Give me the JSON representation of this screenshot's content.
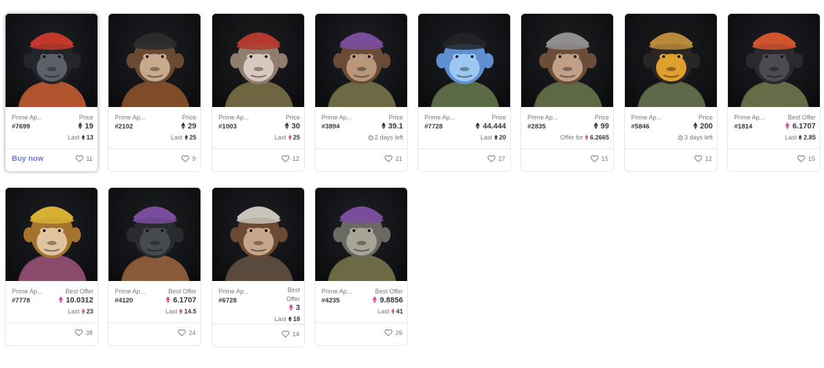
{
  "cards": [
    {
      "collection": "Prime Ap...",
      "token": "#7699",
      "label": "Price",
      "price": "19",
      "price_icon": "eth-black",
      "sub_label": "Last",
      "sub_value": "13",
      "sub_icon": "eth-black",
      "likes": "11",
      "buy": "Buy now",
      "bg": "#1e2126",
      "hat": "#c4382c",
      "fur": "#23252a",
      "face": "#5c6068",
      "jacket": "#b0552e"
    },
    {
      "collection": "Prime Ap...",
      "token": "#2102",
      "label": "Price",
      "price": "29",
      "price_icon": "eth-black",
      "sub_label": "Last",
      "sub_value": "25",
      "sub_icon": "eth-black",
      "likes": "9",
      "bg": "#1d1e21",
      "hat": "#2b2b2e",
      "fur": "#6b4a33",
      "face": "#c9a98d",
      "jacket": "#7f4c2a"
    },
    {
      "collection": "Prime Ap...",
      "token": "#1003",
      "label": "Price",
      "price": "30",
      "price_icon": "eth-black",
      "sub_label": "Last",
      "sub_value": "25",
      "sub_icon": "eth-pink",
      "likes": "12",
      "bg": "#1f1e1c",
      "hat": "#b4382e",
      "fur": "#8f7d70",
      "face": "#d8c8c0",
      "jacket": "#6f6540"
    },
    {
      "collection": "Prime Ap...",
      "token": "#3894",
      "label": "Price",
      "price": "39.1",
      "price_icon": "eth-black",
      "sub_label": "2 days left",
      "sub_value": "",
      "sub_icon": "clock",
      "likes": "21",
      "bg": "#202124",
      "hat": "#7a4c9c",
      "fur": "#6a4b35",
      "face": "#b8977a",
      "jacket": "#6b6a45"
    },
    {
      "collection": "Prime Ap...",
      "token": "#7728",
      "label": "Price",
      "price": "44.444",
      "price_icon": "eth-black",
      "sub_label": "Last",
      "sub_value": "20",
      "sub_icon": "eth-black",
      "likes": "27",
      "bg": "#1c1d20",
      "hat": "#222326",
      "fur": "#5f8fd0",
      "face": "#9cc7f0",
      "jacket": "#5c6a45"
    },
    {
      "collection": "Prime Ap...",
      "token": "#2835",
      "label": "Price",
      "price": "99",
      "price_icon": "eth-black",
      "sub_label": "Offer for",
      "sub_value": "6.2665",
      "sub_icon": "eth-pink",
      "likes": "15",
      "bg": "#1f2022",
      "hat": "#8f8f90",
      "fur": "#6b4e3a",
      "face": "#c2a088",
      "jacket": "#5d6945"
    },
    {
      "collection": "Prime Ap...",
      "token": "#5846",
      "label": "Price",
      "price": "200",
      "price_icon": "eth-black",
      "sub_label": "3 days left",
      "sub_value": "",
      "sub_icon": "clock",
      "likes": "12",
      "bg": "#1a1a1c",
      "hat": "#b98a3a",
      "fur": "#2a2624",
      "face": "#e0a030",
      "jacket": "#5f6848"
    },
    {
      "collection": "Prime Ap...",
      "token": "#1814",
      "label": "Best Offer",
      "price": "6.1707",
      "price_icon": "eth-pink",
      "sub_label": "Last",
      "sub_value": "2.85",
      "sub_icon": "eth-black",
      "likes": "15",
      "bg": "#1d1e21",
      "hat": "#d0542c",
      "fur": "#2a2a2e",
      "face": "#4a4c52",
      "jacket": "#656c48"
    },
    {
      "collection": "Prime Ap...",
      "token": "#7778",
      "label": "Best Offer",
      "price": "10.0312",
      "price_icon": "eth-pink",
      "sub_label": "Last",
      "sub_value": "23",
      "sub_icon": "eth-pink",
      "likes": "38",
      "bg": "#1e1f22",
      "hat": "#d8b032",
      "fur": "#a4742f",
      "face": "#e0c4a0",
      "jacket": "#8a4a6c"
    },
    {
      "collection": "Prime Ap...",
      "token": "#4120",
      "label": "Best Offer",
      "price": "6.1707",
      "price_icon": "eth-pink",
      "sub_label": "Last",
      "sub_value": "14.5",
      "sub_icon": "eth-pink",
      "likes": "24",
      "bg": "#1d1e20",
      "hat": "#7a4c9c",
      "fur": "#2a2b2e",
      "face": "#474a50",
      "jacket": "#8a5a3a"
    },
    {
      "collection": "Prime Ap...",
      "token": "#6728",
      "label": "Best Offer",
      "price": "3",
      "price_icon": "eth-pink",
      "sub_label": "Last",
      "sub_value": "18",
      "sub_icon": "eth-black",
      "likes": "14",
      "bg": "#1e1f22",
      "hat": "#c8c4bc",
      "fur": "#6a4a32",
      "face": "#c6a688",
      "jacket": "#5a4a3e"
    },
    {
      "collection": "Prime Ap...",
      "token": "#4235",
      "label": "Best Offer",
      "price": "9.8856",
      "price_icon": "eth-pink",
      "sub_label": "Last",
      "sub_value": "41",
      "sub_icon": "eth-pink",
      "likes": "26",
      "bg": "#202225",
      "hat": "#7a4c9c",
      "fur": "#6a6a62",
      "face": "#a8a498",
      "jacket": "#6b6a45"
    }
  ],
  "colors": {
    "eth_black": "#353840",
    "eth_pink": "#d14b8f",
    "link_blue": "#6a7cd6",
    "muted": "#707a83",
    "border": "#e5e8eb"
  }
}
